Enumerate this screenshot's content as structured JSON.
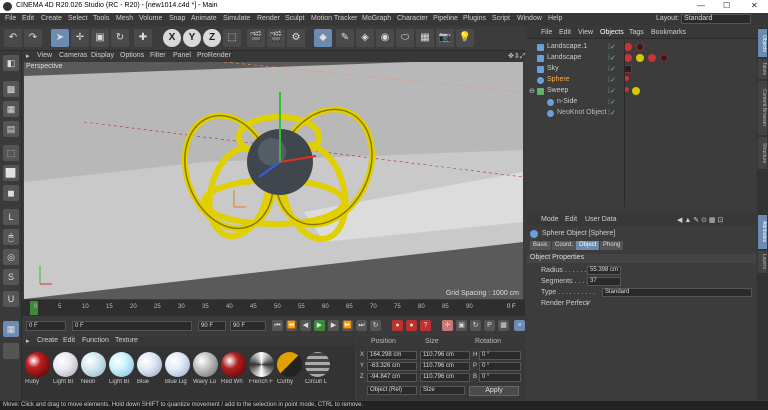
{
  "title": "CINEMA 4D R20.026 Studio (RC - R20) - [new1014.c4d *] - Main",
  "menu": [
    "File",
    "Edit",
    "Create",
    "Select",
    "Tools",
    "Mesh",
    "Volume",
    "Snap",
    "Animate",
    "Simulate",
    "Render",
    "Sculpt",
    "Motion Tracker",
    "MoGraph",
    "Character",
    "Pipeline",
    "Plugins",
    "Script",
    "Window",
    "Help"
  ],
  "layout": {
    "label": "Layout:",
    "value": "Standard"
  },
  "viewport": {
    "menu": [
      "View",
      "Cameras",
      "Display",
      "Options",
      "Filter",
      "Panel",
      "ProRender"
    ],
    "label": "Perspective",
    "grid_spacing": "Grid Spacing : 1000 cm"
  },
  "timeline": {
    "ticks": [
      "0",
      "5",
      "10",
      "15",
      "20",
      "25",
      "30",
      "35",
      "40",
      "45",
      "50",
      "55",
      "60",
      "65",
      "70",
      "75",
      "80",
      "85",
      "90"
    ],
    "end_marker": "0 F"
  },
  "playback": {
    "start": "0 F",
    "current": "0 F",
    "end": "90 F",
    "max": "90 F"
  },
  "materials": {
    "menu": [
      "Create",
      "Edit",
      "Function",
      "Texture"
    ],
    "items": [
      {
        "label": "Ruby",
        "color": "#8a1010"
      },
      {
        "label": "Light Bl",
        "color": "#e8e8f0"
      },
      {
        "label": "Neon",
        "color": "#d0e8f0"
      },
      {
        "label": "Light Bl",
        "color": "#c8f0ff"
      },
      {
        "label": "Blue",
        "color": "#dfe8f5"
      },
      {
        "label": "Blue Lig",
        "color": "#e0eaf5"
      },
      {
        "label": "Wavy Lu",
        "color": "#bfbfbf"
      },
      {
        "label": "Red Wh",
        "color": "#b02020"
      },
      {
        "label": "French F",
        "color": "#cfcfcf"
      },
      {
        "label": "Curby",
        "color": "#e0a000"
      },
      {
        "label": "Circuit L",
        "color": "#888888"
      }
    ]
  },
  "coords": {
    "headers": [
      "Position",
      "Size",
      "Rotation"
    ],
    "rows": [
      {
        "axis": "X",
        "pos": "164.298 cm",
        "size": "110.796 cm",
        "rotlabel": "H",
        "rot": "0 °"
      },
      {
        "axis": "Y",
        "pos": "-63.326 cm",
        "size": "110.796 cm",
        "rotlabel": "P",
        "rot": "0 °"
      },
      {
        "axis": "Z",
        "pos": "-94.847 cm",
        "size": "110.796 cm",
        "rotlabel": "B",
        "rot": "0 °"
      }
    ],
    "mode": "Object (Rel)",
    "size_mode": "Size",
    "apply": "Apply"
  },
  "objects": {
    "tabs": [
      "File",
      "Edit",
      "View",
      "Objects",
      "Tags",
      "Bookmarks"
    ],
    "items": [
      {
        "name": "Landscape.1",
        "indent": 0,
        "color": "#ccc",
        "icon": "#6aa0d8"
      },
      {
        "name": "Landscape",
        "indent": 0,
        "color": "#ccc",
        "icon": "#6aa0d8"
      },
      {
        "name": "Sky",
        "indent": 0,
        "color": "#ccc",
        "icon": "#6aa0d8"
      },
      {
        "name": "Sphere",
        "indent": 0,
        "color": "#ffb050",
        "icon": "#6aa0d8"
      },
      {
        "name": "Sweep",
        "indent": 0,
        "color": "#ccc",
        "icon": "#6ab06a"
      },
      {
        "name": "n-Side",
        "indent": 10,
        "color": "#ccc",
        "icon": "#6aa0d8"
      },
      {
        "name": "NeoKnot Object",
        "indent": 10,
        "color": "#bbb",
        "icon": "#6aa0d8"
      }
    ]
  },
  "attributes": {
    "menu": [
      "Mode",
      "Edit",
      "User Data"
    ],
    "object_title": "Sphere Object [Sphere]",
    "tabs": [
      "Basic",
      "Coord.",
      "Object",
      "Phong"
    ],
    "active_tab": "Object",
    "section": "Object Properties",
    "radius_label": "Radius . . . . . . . .",
    "radius": "55.398 cm",
    "segments_label": "Segments . . . . .",
    "segments": "37",
    "type_label": "Type . . . . . . . . . .",
    "type": "Standard",
    "perfect_label": "Render Perfect",
    "perfect_check": "✓"
  },
  "side_tabs": [
    "Objects",
    "Takes",
    "Content Browser",
    "Structure",
    "Attributes",
    "Layers"
  ],
  "status": "Move: Click and drag to move elements. Hold down SHIFT to quantize movement / add to the selection in point mode, CTRL to remove."
}
